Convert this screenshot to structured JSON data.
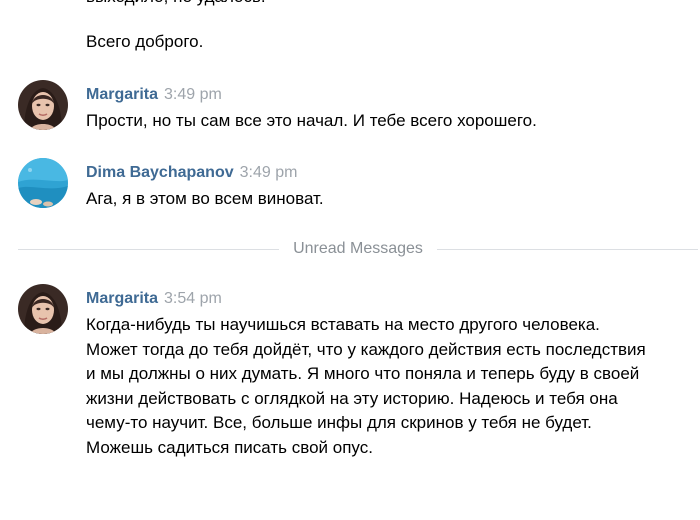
{
  "previous_message": {
    "cut_text": "выходило, не удалось.",
    "continuation": "Всего доброго."
  },
  "messages": [
    {
      "author": "Margarita",
      "time": "3:49 pm",
      "text": "Прости, но ты сам все это начал. И тебе всего хорошего.",
      "avatar": "margarita-avatar"
    },
    {
      "author": "Dima Baychapanov",
      "time": "3:49 pm",
      "text": "Ага, я в этом во всем виноват.",
      "avatar": "dima-avatar"
    },
    {
      "author": "Margarita",
      "time": "3:54 pm",
      "text": "Когда-нибудь ты научишься вставать на место другого человека. Может тогда до тебя дойдёт, что у каждого действия есть последствия и мы должны о них думать. Я много что поняла и теперь буду в своей жизни действовать с оглядкой на эту историю. Надеюсь и тебя она чему-то научит. Все, больше инфы для скринов у тебя не будет. Можешь садиться писать свой опус.",
      "avatar": "margarita-avatar"
    }
  ],
  "divider": {
    "label": "Unread Messages"
  },
  "colors": {
    "author": "#3f6a94",
    "time": "#9ea4ab",
    "divider_line": "#dcdfe3",
    "divider_text": "#8a9096"
  }
}
